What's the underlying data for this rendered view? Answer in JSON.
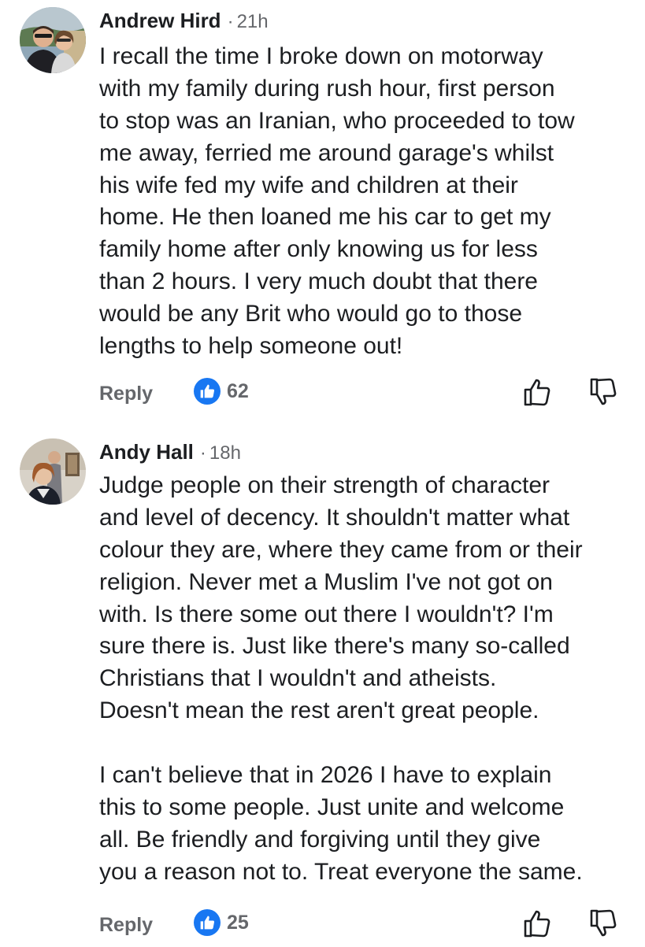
{
  "comments": [
    {
      "author": "Andrew Hird",
      "separator": "·",
      "time": "21h",
      "lines": [
        "I recall the time I broke down on motorway",
        "with my family during rush hour, first person",
        "to stop was an Iranian, who proceeded to tow",
        "me away, ferried me around garage's whilst",
        "his wife fed my wife and children at their",
        "home. He then loaned me his car to get my",
        "family home after only knowing us for less",
        "than 2 hours. I very much doubt that there",
        "would be any Brit who would go to those",
        "lengths to help someone out!"
      ],
      "reply_label": "Reply",
      "like_count": "62"
    },
    {
      "author": "Andy Hall",
      "separator": "·",
      "time": "18h",
      "lines": [
        "Judge people on their strength of character",
        "and level of decency.  It shouldn't matter what",
        "colour they are, where they came from or their",
        "religion.  Never met a Muslim I've not got on",
        "with. Is there some out there I wouldn't? I'm",
        "sure there is. Just like there's many so-called",
        "Christians that I wouldn't and atheists.",
        "Doesn't mean the rest aren't great people.",
        "",
        "I can't believe that in 2026 I have to explain",
        "this to some people.  Just unite and welcome",
        "all. Be friendly and forgiving until they give",
        "you a reason not to. Treat everyone the same."
      ],
      "reply_label": "Reply",
      "like_count": "25"
    }
  ],
  "icons": {
    "reaction": "like-reaction-icon",
    "like": "thumbs-up-icon",
    "dislike": "thumbs-down-icon"
  },
  "colors": {
    "text": "#1c1e21",
    "secondary": "#65676b",
    "like_blue": "#1877f2"
  }
}
